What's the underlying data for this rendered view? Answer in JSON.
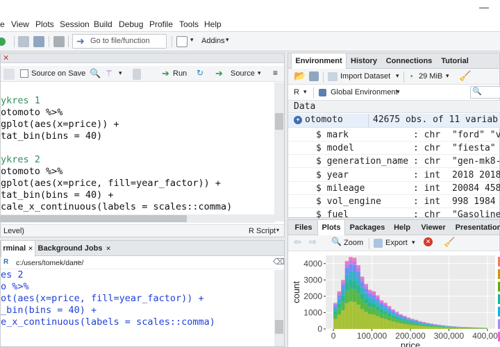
{
  "menu": [
    "e",
    "View",
    "Plots",
    "Session",
    "Build",
    "Debug",
    "Profile",
    "Tools",
    "Help"
  ],
  "toolbar": {
    "goto_placeholder": "Go to file/function",
    "addins_label": "Addins"
  },
  "editor": {
    "source_on_save": "Source on Save",
    "run_label": "Run",
    "source_label": "Source",
    "lines": [
      {
        "cls": "comment",
        "text": "ykres 1"
      },
      {
        "cls": "code",
        "text": "otomoto %>%"
      },
      {
        "cls": "code",
        "text": "gplot(aes(x=price)) +"
      },
      {
        "cls": "code",
        "text": "tat_bin(bins = 40)"
      },
      {
        "cls": "code",
        "text": ""
      },
      {
        "cls": "comment",
        "text": "ykres 2"
      },
      {
        "cls": "code",
        "text": "otomoto %>%"
      },
      {
        "cls": "code",
        "text": "gplot(aes(x=price, fill=year_factor)) +"
      },
      {
        "cls": "code",
        "text": "tat_bin(bins = 40) +"
      },
      {
        "cls": "code",
        "text": "cale_x_continuous(labels = scales::comma)"
      }
    ],
    "status_left": "Level)",
    "status_right": "R Script"
  },
  "console": {
    "tabs": [
      "rminal",
      "Background Jobs"
    ],
    "path": "c:/users/tomek/dane/",
    "lines": [
      "es 2",
      "o %>%",
      "ot(aes(x=price, fill=year_factor)) +",
      "_bin(bins = 40) +",
      "e_x_continuous(labels = scales::comma)"
    ]
  },
  "environment": {
    "tabs": [
      "Environment",
      "History",
      "Connections",
      "Tutorial"
    ],
    "import_label": "Import Dataset",
    "memory_label": "29 MiB",
    "lang": "R",
    "scope": "Global Environment",
    "section": "Data",
    "object_name": "otomoto",
    "object_desc": "42675 obs. of 11 variab",
    "rows": [
      {
        "name": "$ mark",
        "type": ": chr",
        "val": "\"ford\" \"v"
      },
      {
        "name": "$ model",
        "type": ": chr",
        "val": "\"fiesta\""
      },
      {
        "name": "$ generation_name",
        "type": ": chr",
        "val": "\"gen-mk8-"
      },
      {
        "name": "$ year",
        "type": ": int",
        "val": "2018 2018"
      },
      {
        "name": "$ mileage",
        "type": ": int",
        "val": "20084 458"
      },
      {
        "name": "$ vol_engine",
        "type": ": int",
        "val": "998 1984"
      },
      {
        "name": "$ fuel",
        "type": ": chr",
        "val": "\"Gasoline"
      }
    ]
  },
  "plots_pane": {
    "tabs": [
      "Files",
      "Plots",
      "Packages",
      "Help",
      "Viewer",
      "Presentation"
    ],
    "zoom_label": "Zoom",
    "export_label": "Export"
  },
  "chart_data": {
    "type": "bar",
    "xlabel": "price",
    "ylabel": "count",
    "xlim": [
      -20000,
      420000
    ],
    "ylim": [
      0,
      4500
    ],
    "x_ticks": [
      "0",
      "100,000",
      "200,000",
      "300,000",
      "400,000"
    ],
    "x_tick_values": [
      0,
      100000,
      200000,
      300000,
      400000
    ],
    "y_ticks": [
      "0",
      "1000",
      "2000",
      "3000",
      "4000"
    ],
    "y_tick_values": [
      0,
      1000,
      2000,
      3000,
      4000
    ],
    "bin_width": 10000,
    "bin_start": 0,
    "totals": [
      1600,
      2300,
      3000,
      4150,
      4400,
      4350,
      3900,
      3200,
      2750,
      2400,
      2300,
      2050,
      1750,
      1600,
      1400,
      1200,
      1050,
      900,
      800,
      700,
      620,
      560,
      480,
      420,
      370,
      330,
      290,
      260,
      230,
      200,
      180,
      160,
      140,
      130,
      120,
      110,
      100,
      90,
      80,
      70
    ],
    "fractions": [
      0.38,
      0.18,
      0.12,
      0.12,
      0.1,
      0.06,
      0.04
    ],
    "colors": [
      "#a7c236",
      "#57b847",
      "#2cb58d",
      "#35b0c9",
      "#6d8ff2",
      "#c879e8",
      "#f07ab5"
    ],
    "top_color": "#ef7d6f",
    "legend_swatch_colors": [
      "#f8766d",
      "#c49a00",
      "#53b400",
      "#00c094",
      "#00b6eb",
      "#a58aff",
      "#fb61d7"
    ]
  }
}
